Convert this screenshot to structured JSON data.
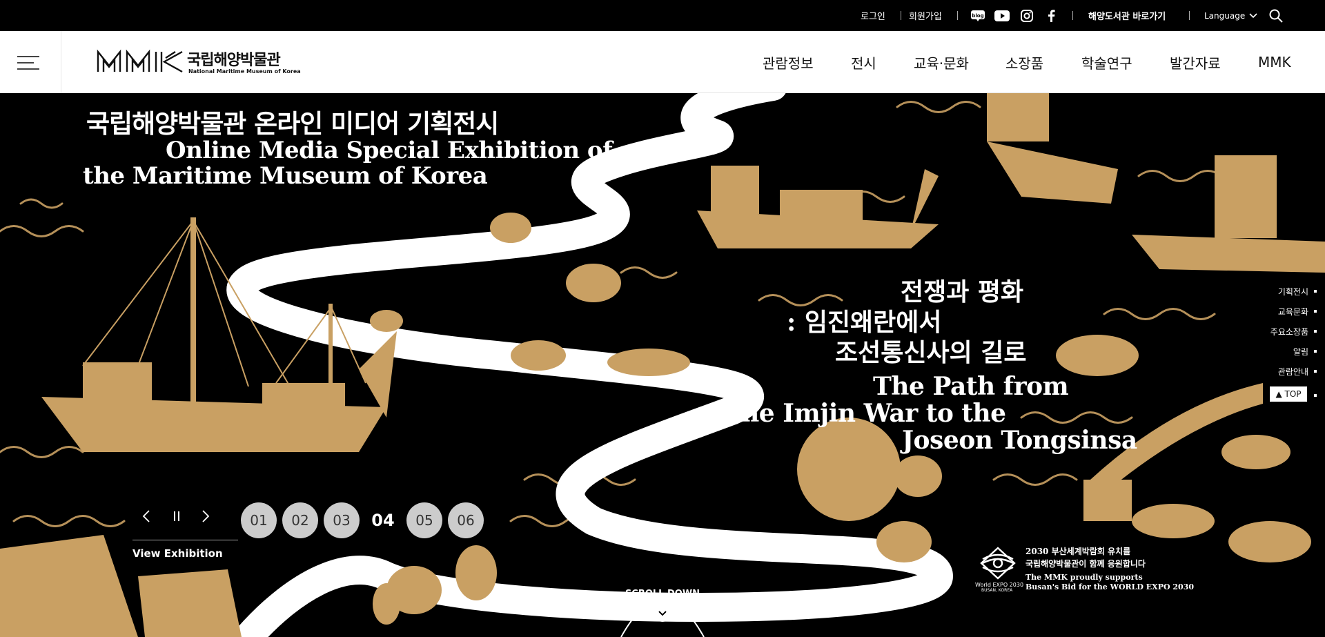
{
  "topbar": {
    "login": "로그인",
    "join": "회원가입",
    "library": "해양도서관 바로가기",
    "language": "Language",
    "social": [
      "blog-icon",
      "youtube-icon",
      "instagram-icon",
      "facebook-icon"
    ]
  },
  "header": {
    "logo_ko": "국립해양박물관",
    "logo_en": "National Maritime Museum of Korea",
    "nav": [
      "관람정보",
      "전시",
      "교육·문화",
      "소장품",
      "학술연구",
      "발간자료",
      "MMK"
    ]
  },
  "hero": {
    "title_ko": "국립해양박물관 온라인 미디어 기획전시",
    "title_en_1": "Online Media Special Exhibition of",
    "title_en_2": "the Maritime Museum of Korea",
    "subtitle_ko_1": "전쟁과 평화",
    "subtitle_ko_2": ": 임진왜란에서",
    "subtitle_ko_3": "조선통신사의 길로",
    "subtitle_en_1": "The Path from",
    "subtitle_en_2": "the Imjin War to the",
    "subtitle_en_3": "Joseon Tongsinsa",
    "view_exhibition": "View Exhibition",
    "slides": [
      "01",
      "02",
      "03",
      "04",
      "05",
      "06"
    ],
    "active_slide": "04",
    "scroll_down": "SCROLL DOWN",
    "expo": {
      "line1": "2030 부산세계박람회 유치를",
      "line2": "국립해양박물관이 함께 응원합니다",
      "line3": "The MMK proudly supports",
      "line4": "Busan's Bid for the WORLD EXPO 2030",
      "caption": "World EXPO 2030",
      "caption2": "BUSAN, KOREA"
    }
  },
  "quick_menu": [
    "기획전시",
    "교육문화",
    "주요소장품",
    "알림",
    "관람안내"
  ],
  "top_button": "▲ TOP",
  "colors": {
    "gold": "#c9a063",
    "black": "#000000",
    "white": "#ffffff"
  }
}
